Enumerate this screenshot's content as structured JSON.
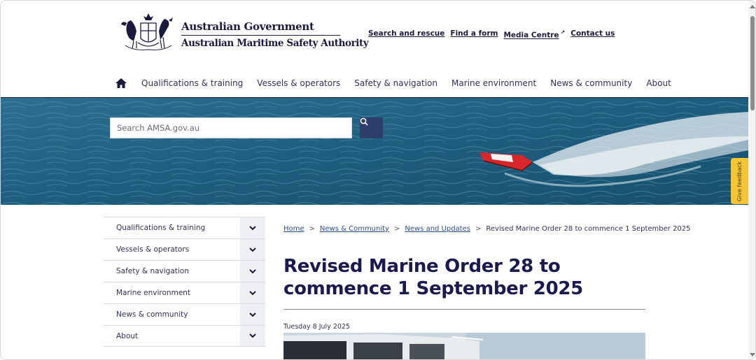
{
  "header": {
    "logo_line1": "Australian Government",
    "logo_line2": "Australian Maritime Safety Authority",
    "top_links": [
      {
        "label": "Search and rescue"
      },
      {
        "label": "Find a form"
      },
      {
        "label": "Media Centre"
      },
      {
        "label": "Contact us"
      }
    ],
    "nav": [
      "Qualifications & training",
      "Vessels & operators",
      "Safety & navigation",
      "Marine environment",
      "News & community",
      "About"
    ]
  },
  "search": {
    "placeholder": "Search AMSA.gov.au"
  },
  "feedback": {
    "label": "Give feedback"
  },
  "sidebar": {
    "items": [
      "Qualifications & training",
      "Vessels & operators",
      "Safety & navigation",
      "Marine environment",
      "News & community",
      "About"
    ]
  },
  "breadcrumb": {
    "home": "Home",
    "news": "News & Community",
    "updates": "News and Updates",
    "current": "Revised Marine Order 28 to commence 1 September 2025",
    "separator": ">"
  },
  "article": {
    "title": "Revised Marine Order 28 to commence 1 September 2025",
    "date": "Tuesday 8 July 2025"
  },
  "colors": {
    "brand": "#1a1a3e",
    "feedback": "#f6c532",
    "search_button": "#2c3e6b"
  },
  "icons": {
    "home": "home-icon",
    "search": "search-icon",
    "chevron": "chevron-down-icon",
    "external": "external-link-icon"
  }
}
